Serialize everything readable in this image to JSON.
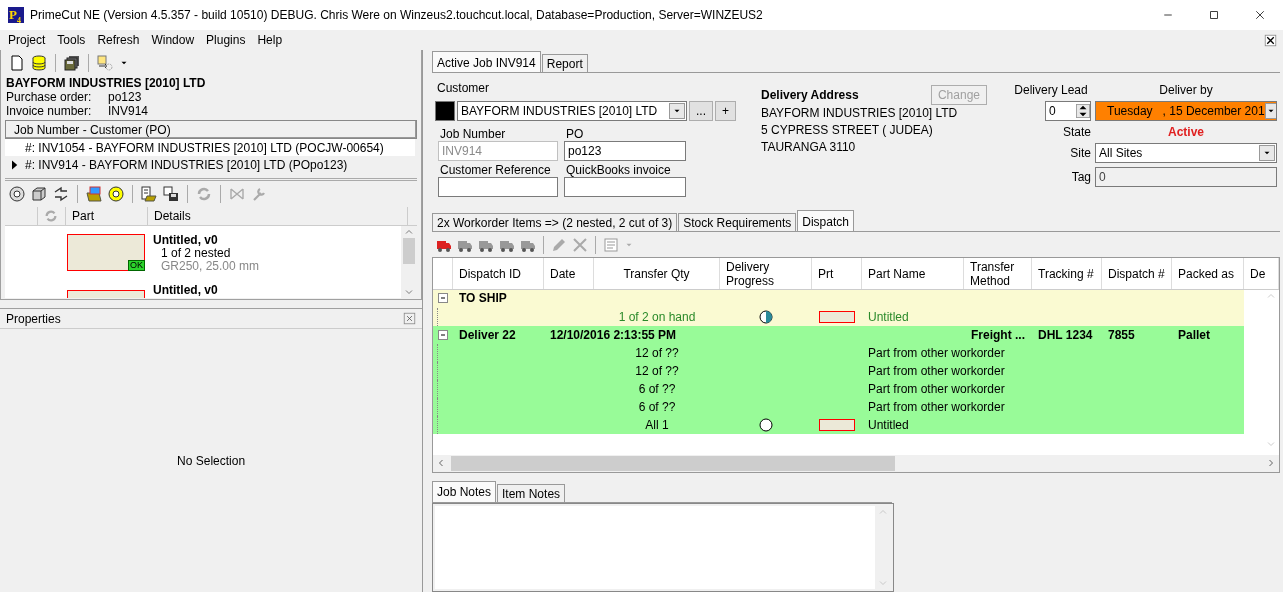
{
  "window": {
    "logo": "P$_{4}$",
    "title": "PrimeCut NE (Version 4.5.357 - build 10510) DEBUG. Chris Were on Winzeus2.touchcut.local, Database=Production, Server=WINZEUS2"
  },
  "menu": [
    "Project",
    "Tools",
    "Refresh",
    "Window",
    "Plugins",
    "Help"
  ],
  "job_summary": {
    "customer": "BAYFORM INDUSTRIES [2010] LTD",
    "fields": [
      {
        "label": "Purchase order:",
        "value": "po123"
      },
      {
        "label": "Invoice number:",
        "value": "INV914"
      }
    ]
  },
  "job_list": {
    "header": "Job Number - Customer (PO)",
    "rows": [
      {
        "text": "#: INV1054 - BAYFORM INDUSTRIES [2010] LTD (POCJW-00654)",
        "selected": false
      },
      {
        "text": "#: INV914 - BAYFORM INDUSTRIES [2010] LTD (POpo123)",
        "selected": true
      }
    ]
  },
  "parts": {
    "columns": [
      "Part",
      "Details"
    ],
    "rows": [
      {
        "title": "Untitled, v0",
        "nested": "1 of 2 nested",
        "material": "GR250, 25.00 mm",
        "badge": "OK"
      },
      {
        "title": "Untitled, v0"
      }
    ]
  },
  "properties": {
    "title": "Properties",
    "empty": "No Selection"
  },
  "tabs": [
    {
      "label": "Active Job INV914",
      "selected": true
    },
    {
      "label": "Report",
      "selected": false
    }
  ],
  "job": {
    "customer_label": "Customer",
    "customer": "BAYFORM INDUSTRIES [2010] LTD",
    "buttons": [
      "...",
      "+"
    ],
    "fields": [
      {
        "label": "Job Number",
        "value": "INV914",
        "disabled": true
      },
      {
        "label": "PO",
        "value": "po123",
        "disabled": false
      },
      {
        "label": "Customer Reference",
        "disabled": false
      },
      {
        "label": "QuickBooks invoice",
        "disabled": false
      }
    ]
  },
  "delivery_address": {
    "title": "Delivery Address",
    "lines": [
      "BAYFORM INDUSTRIES [2010] LTD",
      "5 CYPRESS STREET ( JUDEA)",
      "TAURANGA  3110"
    ],
    "change_button": {
      "label": "Change",
      "disabled": true
    }
  },
  "delivery": {
    "lead_label": "Delivery Lead",
    "lead_value": "0",
    "deliver_by_label": "Deliver by",
    "deliver_by_value": "Tuesday   , 15 December 201",
    "state_label": "State",
    "state_value": "Active",
    "site_label": "Site",
    "site_value": "All Sites",
    "tag_label": "Tag",
    "tag_value": "0"
  },
  "inner_tabs": [
    {
      "label": "2x Workorder Items => (2 nested, 2 cut of 3)",
      "selected": false
    },
    {
      "label": "Stock Requirements",
      "selected": false
    },
    {
      "label": "Dispatch",
      "selected": true
    }
  ],
  "dispatch": {
    "columns": [
      "Dispatch ID",
      "Date",
      "Transfer Qty",
      "Delivery Progress",
      "Prt",
      "Part Name",
      "Transfer Method",
      "Tracking #",
      "Dispatch #",
      "Packed as",
      "De"
    ],
    "groups": [
      {
        "label": "TO SHIP",
        "color": "#fafad2",
        "expanded": true,
        "children": [
          {
            "transfer_qty": "1 of 2 on hand",
            "level": 0.5,
            "thumbnail": true,
            "part_name": "Untitled",
            "on_hand": true
          }
        ]
      },
      {
        "label": "Deliver 22",
        "date": "12/10/2016 2:13:55 PM",
        "transfer_method": "Freight ...",
        "tracking": "DHL 1234",
        "dispatch_no": "7855",
        "packed_as": "Pallet",
        "color": "#98fb98",
        "expanded": true,
        "children": [
          {
            "transfer_qty": "12 of ??",
            "thumbnail": false,
            "part_name": "Part from other workorder",
            "on_hand": false
          },
          {
            "transfer_qty": "12 of ??",
            "thumbnail": false,
            "part_name": "Part from other workorder",
            "on_hand": false
          },
          {
            "transfer_qty": "6 of ??",
            "thumbnail": false,
            "part_name": "Part from other workorder",
            "on_hand": false
          },
          {
            "transfer_qty": "6 of ??",
            "thumbnail": false,
            "part_name": "Part from other workorder",
            "on_hand": false
          },
          {
            "transfer_qty": "All 1",
            "level": 0,
            "thumbnail": true,
            "part_name": "Untitled",
            "on_hand": false
          }
        ]
      }
    ]
  },
  "notes_tabs": [
    {
      "label": "Job Notes",
      "selected": true
    },
    {
      "label": "Item Notes",
      "selected": false
    }
  ]
}
